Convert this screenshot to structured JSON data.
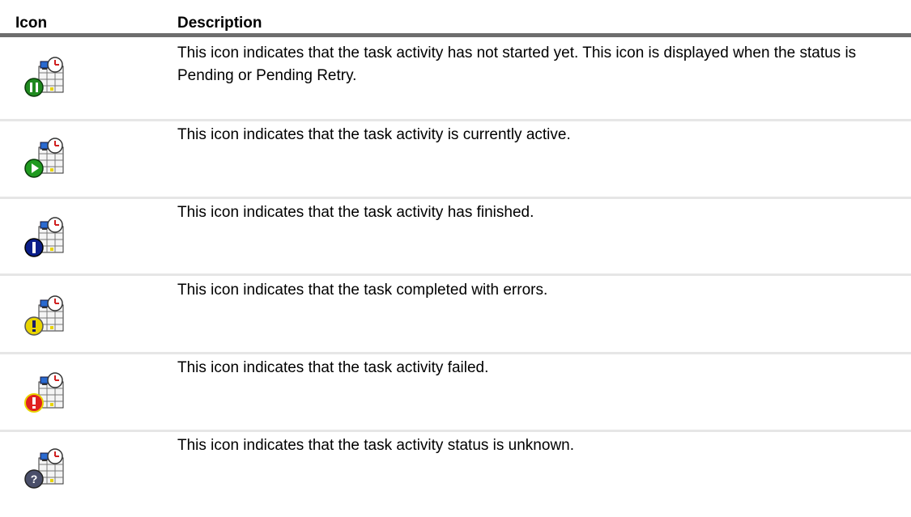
{
  "table": {
    "headers": {
      "icon": "Icon",
      "description": "Description"
    },
    "rows": [
      {
        "icon": "task-pending-icon",
        "badge_color": "#1f8a1f",
        "description": "This icon indicates that the task activity has not started yet. This icon is displayed when the status is Pending or Pending Retry."
      },
      {
        "icon": "task-active-icon",
        "badge_color": "#1f9a1f",
        "description": "This icon indicates that the task activity is currently active."
      },
      {
        "icon": "task-finished-icon",
        "badge_color": "#0a1e8a",
        "description": "This icon indicates that the task activity has finished."
      },
      {
        "icon": "task-completed-with-errors-icon",
        "badge_color": "#e8d400",
        "description": "This icon indicates that the task completed with errors."
      },
      {
        "icon": "task-failed-icon",
        "badge_color": "#e02020",
        "description": "This icon indicates that the task activity failed."
      },
      {
        "icon": "task-unknown-icon",
        "badge_color": "#4a4f6a",
        "description": "This icon indicates that the task activity status is unknown."
      }
    ]
  },
  "colors": {
    "header_rule": "#6d6d6d",
    "row_divider": "#e6e6e6",
    "clock_hand": "#d02020",
    "monitor": "#2a6ad0"
  }
}
